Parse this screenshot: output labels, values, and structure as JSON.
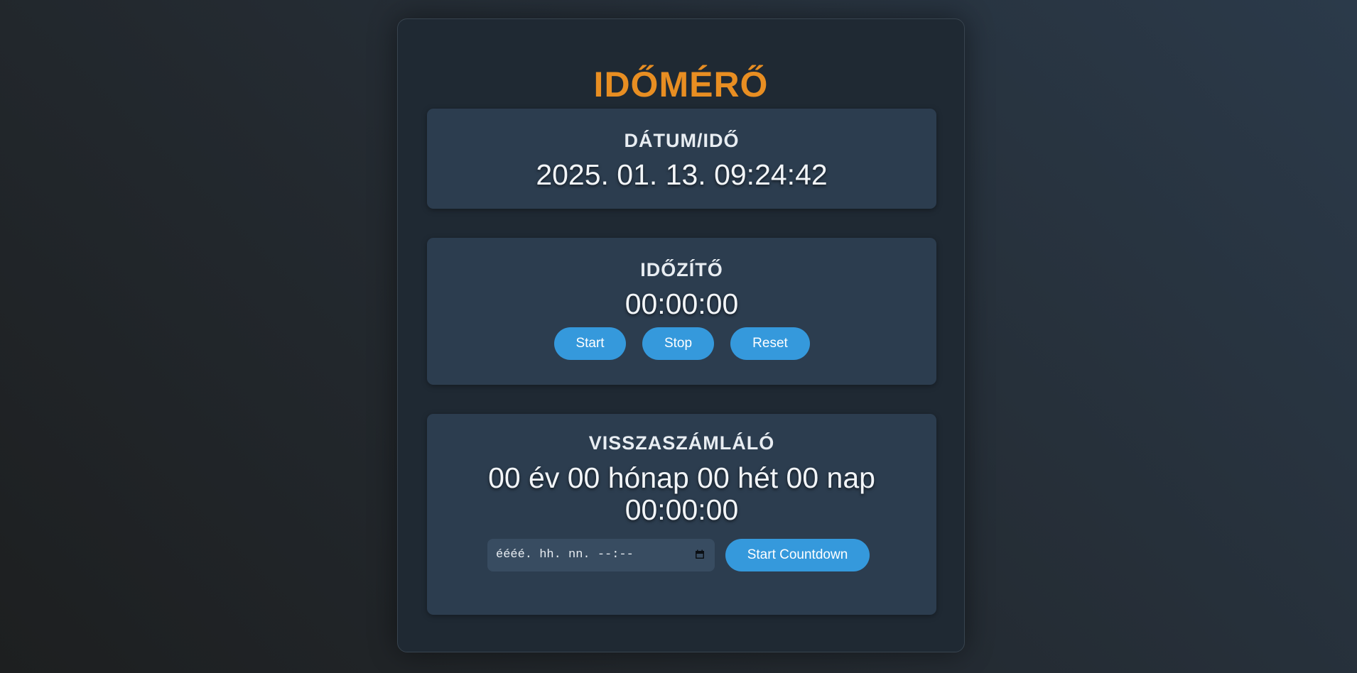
{
  "app": {
    "title": "IDŐMÉRŐ"
  },
  "datetime": {
    "heading": "DÁTUM/IDŐ",
    "value": "2025. 01. 13. 09:24:42"
  },
  "timer": {
    "heading": "IDŐZÍTŐ",
    "value": "00:00:00",
    "start_label": "Start",
    "stop_label": "Stop",
    "reset_label": "Reset"
  },
  "countdown": {
    "heading": "VISSZASZÁMLÁLÓ",
    "line1": "00 év 00 hónap 00 hét 00 nap",
    "line2": "00:00:00",
    "input_placeholder": "éééé. hh. nn. --:--",
    "start_label": "Start Countdown",
    "calendar_icon": "calendar-icon"
  },
  "colors": {
    "accent": "#e88e22",
    "button": "#3599dc",
    "card": "#2c3d4f",
    "panel": "#1f2933"
  }
}
